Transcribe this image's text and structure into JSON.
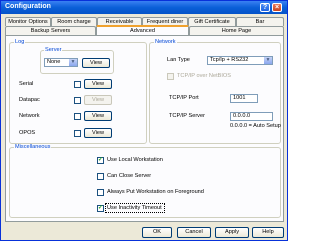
{
  "window": {
    "title": "Configuration"
  },
  "tabs_row1": [
    "Monitor Options",
    "Room charge",
    "Receivable",
    "Frequent diner",
    "Gift Certificate",
    "Bar"
  ],
  "tabs_row2": [
    "Backup Servers",
    "Advanced",
    "Home Page"
  ],
  "log": {
    "title": "Log",
    "server": {
      "title": "Server",
      "value": "None",
      "view": "View"
    },
    "items": [
      {
        "label": "Serial",
        "view": "View",
        "enabled": true
      },
      {
        "label": "Datapac",
        "view": "View",
        "enabled": false
      },
      {
        "label": "Network",
        "view": "View",
        "enabled": true
      },
      {
        "label": "OPOS",
        "view": "View",
        "enabled": true
      }
    ]
  },
  "network": {
    "title": "Network",
    "lan_type_label": "Lan Type",
    "lan_type_value": "Tcp/Ip + RS232",
    "netbios_label": "TCP/IP over NetBIOS",
    "port_label": "TCP/IP Port",
    "port_value": "1001",
    "server_label": "TCP/IP Server",
    "server_value": "0.0.0.0",
    "server_hint": "0.0.0.0 = Auto Setup"
  },
  "misc": {
    "title": "Miscellaneous",
    "items": [
      {
        "label": "Use Local Workstation",
        "checked": true
      },
      {
        "label": "Can Close Server",
        "checked": false
      },
      {
        "label": "Always Put Workstation on Foreground",
        "checked": false
      },
      {
        "label": "Use Inactivity Timeout",
        "checked": true
      }
    ]
  },
  "buttons": {
    "ok": "OK",
    "cancel": "Cancel",
    "apply": "Apply",
    "help": "Help"
  }
}
